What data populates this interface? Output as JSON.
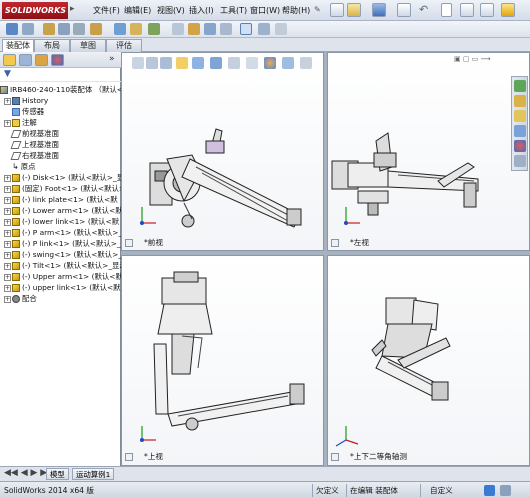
{
  "app": {
    "logo_text": "SOLIDWORKS",
    "menu": [
      "文件(F)",
      "编辑(E)",
      "视图(V)",
      "插入(I)",
      "工具(T)",
      "窗口(W)",
      "帮助(H)"
    ]
  },
  "manager_tabs": [
    {
      "label": "装配体"
    },
    {
      "label": "布局"
    },
    {
      "label": "草图"
    },
    {
      "label": "评估"
    }
  ],
  "tree": {
    "root": "IRB460-240-110装配体 （默认<显",
    "items": [
      {
        "text": "History",
        "icon": "folder-icon",
        "expandable": true
      },
      {
        "text": "传感器",
        "icon": "sensor-icon",
        "expandable": false
      },
      {
        "text": "注解",
        "icon": "annotation-icon",
        "expandable": true
      },
      {
        "text": "前视基准面",
        "icon": "plane-icon",
        "expandable": false
      },
      {
        "text": "上视基准面",
        "icon": "plane-icon",
        "expandable": false
      },
      {
        "text": "右视基准面",
        "icon": "plane-icon",
        "expandable": false
      },
      {
        "text": "原点",
        "icon": "origin-icon",
        "expandable": false
      },
      {
        "text": "(-) Disk<1> (默认<默认>_显",
        "icon": "part-icon",
        "expandable": true
      },
      {
        "text": "(固定) Foot<1> (默认<默认>_",
        "icon": "part-icon",
        "expandable": true
      },
      {
        "text": "(-) link plate<1> (默认<默",
        "icon": "part-icon",
        "expandable": true
      },
      {
        "text": "(-) Lower arm<1> (默认<默认",
        "icon": "part-icon",
        "expandable": true
      },
      {
        "text": "(-) lower link<1> (默认<默",
        "icon": "part-icon",
        "expandable": true
      },
      {
        "text": "(-) P arm<1> (默认<默认>_显",
        "icon": "part-icon",
        "expandable": true
      },
      {
        "text": "(-) P link<1> (默认<默认>_",
        "icon": "part-icon",
        "expandable": true
      },
      {
        "text": "(-) swing<1> (默认<默认>_显",
        "icon": "part-icon",
        "expandable": true
      },
      {
        "text": "(-) Tilt<1> (默认<默认>_显示",
        "icon": "part-icon",
        "expandable": true
      },
      {
        "text": "(-) Upper arm<1> (默认<默认",
        "icon": "part-icon",
        "expandable": true
      },
      {
        "text": "(-) upper link<1> (默认<默",
        "icon": "part-icon",
        "expandable": true
      },
      {
        "text": "配合",
        "icon": "mate-icon",
        "expandable": true
      }
    ]
  },
  "viewports": [
    {
      "label": "*前视"
    },
    {
      "label": "*左视"
    },
    {
      "label": "*上视"
    },
    {
      "label": "*上下二等角轴测"
    }
  ],
  "bottom_tabs": [
    "模型",
    "运动算例1"
  ],
  "status": {
    "app_version": "SolidWorks 2014 x64 版",
    "constraint": "欠定义",
    "mode": "在编辑 装配体",
    "units": "自定义"
  },
  "colors": {
    "brand": "#c1282e",
    "accent": "#2f5ea8"
  }
}
